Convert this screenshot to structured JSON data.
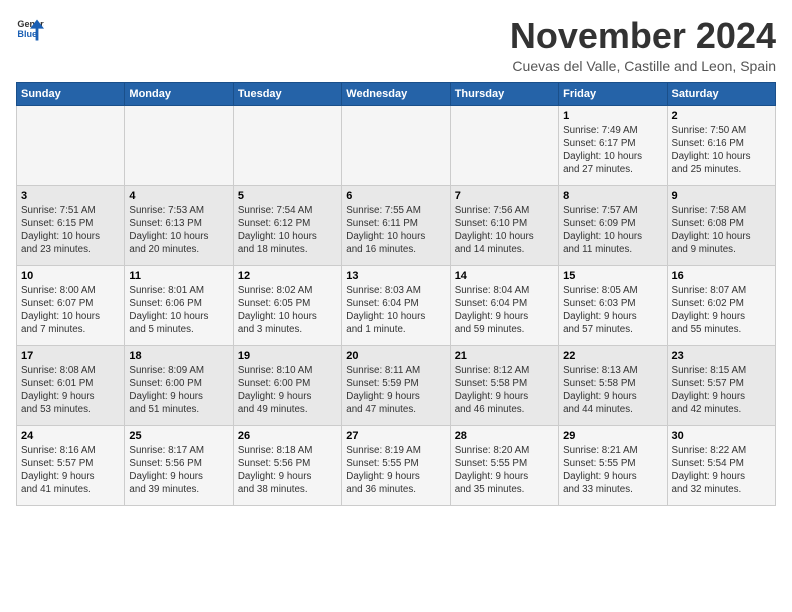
{
  "header": {
    "logo_general": "General",
    "logo_blue": "Blue",
    "month_title": "November 2024",
    "subtitle": "Cuevas del Valle, Castille and Leon, Spain"
  },
  "weekdays": [
    "Sunday",
    "Monday",
    "Tuesday",
    "Wednesday",
    "Thursday",
    "Friday",
    "Saturday"
  ],
  "weeks": [
    [
      {
        "day": "",
        "info": ""
      },
      {
        "day": "",
        "info": ""
      },
      {
        "day": "",
        "info": ""
      },
      {
        "day": "",
        "info": ""
      },
      {
        "day": "",
        "info": ""
      },
      {
        "day": "1",
        "info": "Sunrise: 7:49 AM\nSunset: 6:17 PM\nDaylight: 10 hours\nand 27 minutes."
      },
      {
        "day": "2",
        "info": "Sunrise: 7:50 AM\nSunset: 6:16 PM\nDaylight: 10 hours\nand 25 minutes."
      }
    ],
    [
      {
        "day": "3",
        "info": "Sunrise: 7:51 AM\nSunset: 6:15 PM\nDaylight: 10 hours\nand 23 minutes."
      },
      {
        "day": "4",
        "info": "Sunrise: 7:53 AM\nSunset: 6:13 PM\nDaylight: 10 hours\nand 20 minutes."
      },
      {
        "day": "5",
        "info": "Sunrise: 7:54 AM\nSunset: 6:12 PM\nDaylight: 10 hours\nand 18 minutes."
      },
      {
        "day": "6",
        "info": "Sunrise: 7:55 AM\nSunset: 6:11 PM\nDaylight: 10 hours\nand 16 minutes."
      },
      {
        "day": "7",
        "info": "Sunrise: 7:56 AM\nSunset: 6:10 PM\nDaylight: 10 hours\nand 14 minutes."
      },
      {
        "day": "8",
        "info": "Sunrise: 7:57 AM\nSunset: 6:09 PM\nDaylight: 10 hours\nand 11 minutes."
      },
      {
        "day": "9",
        "info": "Sunrise: 7:58 AM\nSunset: 6:08 PM\nDaylight: 10 hours\nand 9 minutes."
      }
    ],
    [
      {
        "day": "10",
        "info": "Sunrise: 8:00 AM\nSunset: 6:07 PM\nDaylight: 10 hours\nand 7 minutes."
      },
      {
        "day": "11",
        "info": "Sunrise: 8:01 AM\nSunset: 6:06 PM\nDaylight: 10 hours\nand 5 minutes."
      },
      {
        "day": "12",
        "info": "Sunrise: 8:02 AM\nSunset: 6:05 PM\nDaylight: 10 hours\nand 3 minutes."
      },
      {
        "day": "13",
        "info": "Sunrise: 8:03 AM\nSunset: 6:04 PM\nDaylight: 10 hours\nand 1 minute."
      },
      {
        "day": "14",
        "info": "Sunrise: 8:04 AM\nSunset: 6:04 PM\nDaylight: 9 hours\nand 59 minutes."
      },
      {
        "day": "15",
        "info": "Sunrise: 8:05 AM\nSunset: 6:03 PM\nDaylight: 9 hours\nand 57 minutes."
      },
      {
        "day": "16",
        "info": "Sunrise: 8:07 AM\nSunset: 6:02 PM\nDaylight: 9 hours\nand 55 minutes."
      }
    ],
    [
      {
        "day": "17",
        "info": "Sunrise: 8:08 AM\nSunset: 6:01 PM\nDaylight: 9 hours\nand 53 minutes."
      },
      {
        "day": "18",
        "info": "Sunrise: 8:09 AM\nSunset: 6:00 PM\nDaylight: 9 hours\nand 51 minutes."
      },
      {
        "day": "19",
        "info": "Sunrise: 8:10 AM\nSunset: 6:00 PM\nDaylight: 9 hours\nand 49 minutes."
      },
      {
        "day": "20",
        "info": "Sunrise: 8:11 AM\nSunset: 5:59 PM\nDaylight: 9 hours\nand 47 minutes."
      },
      {
        "day": "21",
        "info": "Sunrise: 8:12 AM\nSunset: 5:58 PM\nDaylight: 9 hours\nand 46 minutes."
      },
      {
        "day": "22",
        "info": "Sunrise: 8:13 AM\nSunset: 5:58 PM\nDaylight: 9 hours\nand 44 minutes."
      },
      {
        "day": "23",
        "info": "Sunrise: 8:15 AM\nSunset: 5:57 PM\nDaylight: 9 hours\nand 42 minutes."
      }
    ],
    [
      {
        "day": "24",
        "info": "Sunrise: 8:16 AM\nSunset: 5:57 PM\nDaylight: 9 hours\nand 41 minutes."
      },
      {
        "day": "25",
        "info": "Sunrise: 8:17 AM\nSunset: 5:56 PM\nDaylight: 9 hours\nand 39 minutes."
      },
      {
        "day": "26",
        "info": "Sunrise: 8:18 AM\nSunset: 5:56 PM\nDaylight: 9 hours\nand 38 minutes."
      },
      {
        "day": "27",
        "info": "Sunrise: 8:19 AM\nSunset: 5:55 PM\nDaylight: 9 hours\nand 36 minutes."
      },
      {
        "day": "28",
        "info": "Sunrise: 8:20 AM\nSunset: 5:55 PM\nDaylight: 9 hours\nand 35 minutes."
      },
      {
        "day": "29",
        "info": "Sunrise: 8:21 AM\nSunset: 5:55 PM\nDaylight: 9 hours\nand 33 minutes."
      },
      {
        "day": "30",
        "info": "Sunrise: 8:22 AM\nSunset: 5:54 PM\nDaylight: 9 hours\nand 32 minutes."
      }
    ]
  ]
}
